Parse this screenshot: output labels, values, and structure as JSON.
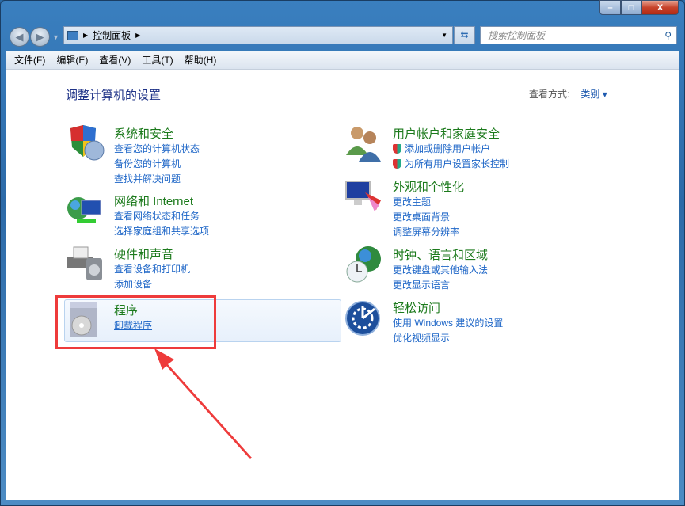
{
  "window": {
    "minimize": "–",
    "maximize": "□",
    "close": "X"
  },
  "address": {
    "path": "控制面板",
    "search_placeholder": "搜索控制面板"
  },
  "menu": [
    "文件(F)",
    "编辑(E)",
    "查看(V)",
    "工具(T)",
    "帮助(H)"
  ],
  "page": {
    "title": "调整计算机的设置",
    "view_by_label": "查看方式:",
    "view_by_value": "类别"
  },
  "categories": [
    {
      "title": "系统和安全",
      "links": [
        "查看您的计算机状态",
        "备份您的计算机",
        "查找并解决问题"
      ]
    },
    {
      "title": "网络和 Internet",
      "links": [
        "查看网络状态和任务",
        "选择家庭组和共享选项"
      ]
    },
    {
      "title": "硬件和声音",
      "links": [
        "查看设备和打印机",
        "添加设备"
      ]
    },
    {
      "title": "程序",
      "links": [
        "卸载程序"
      ]
    },
    {
      "title": "用户帐户和家庭安全",
      "links": [
        "添加或删除用户帐户",
        "为所有用户设置家长控制"
      ]
    },
    {
      "title": "外观和个性化",
      "links": [
        "更改主题",
        "更改桌面背景",
        "调整屏幕分辨率"
      ]
    },
    {
      "title": "时钟、语言和区域",
      "links": [
        "更改键盘或其他输入法",
        "更改显示语言"
      ]
    },
    {
      "title": "轻松访问",
      "links": [
        "使用 Windows 建议的设置",
        "优化视频显示"
      ]
    }
  ],
  "colors": {
    "highlight": "#ee3b3b",
    "title_green": "#1c7a1c",
    "link_blue": "#1e66c7"
  }
}
